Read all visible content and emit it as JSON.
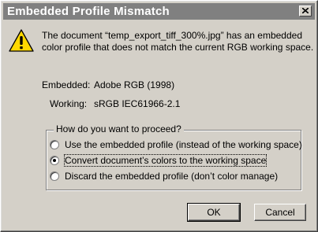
{
  "dialog": {
    "title": "Embedded Profile Mismatch",
    "message_line1": "The document “temp_export_tiff_300%.jpg” has an embedded",
    "message_line2": "color profile that does not match the current RGB working space."
  },
  "profiles": {
    "embedded_label": "Embedded:",
    "embedded_value": "Adobe RGB (1998)",
    "working_label": "Working:",
    "working_value": "sRGB IEC61966-2.1"
  },
  "options": {
    "legend": "How do you want to proceed?",
    "items": [
      {
        "label": "Use the embedded profile (instead of the working space)",
        "selected": false
      },
      {
        "label": "Convert document’s colors to the working space",
        "selected": true
      },
      {
        "label": "Discard the embedded profile (don’t color manage)",
        "selected": false
      }
    ]
  },
  "buttons": {
    "ok": "OK",
    "cancel": "Cancel"
  },
  "icons": {
    "warning": "warning-icon",
    "close": "close-icon"
  }
}
